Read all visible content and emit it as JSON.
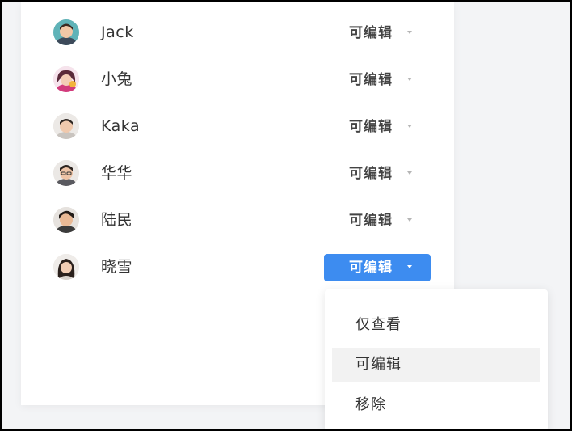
{
  "members": [
    {
      "name": "Jack",
      "permission": "可编辑",
      "avatar": "avatar-jack"
    },
    {
      "name": "小兔",
      "permission": "可编辑",
      "avatar": "avatar-xiaotu"
    },
    {
      "name": "Kaka",
      "permission": "可编辑",
      "avatar": "avatar-kaka"
    },
    {
      "name": "华华",
      "permission": "可编辑",
      "avatar": "avatar-huahua"
    },
    {
      "name": "陆民",
      "permission": "可编辑",
      "avatar": "avatar-lumin"
    },
    {
      "name": "晓雪",
      "permission": "可编辑",
      "avatar": "avatar-xiaoxue"
    }
  ],
  "dropdown": {
    "options": [
      "仅查看",
      "可编辑",
      "移除"
    ],
    "highlighted": "可编辑"
  },
  "colors": {
    "accent": "#3d8cf0",
    "text": "#333333",
    "caret": "#b5b5b5",
    "hover": "#f2f2f2"
  }
}
